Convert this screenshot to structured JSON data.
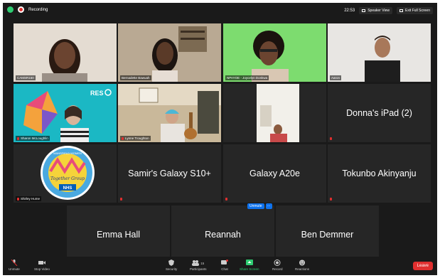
{
  "topbar": {
    "recording_label": "Recording",
    "time": "22:53",
    "speaker_view_label": "Speaker View",
    "exit_fullscreen_label": "Exit Full Screen"
  },
  "participants": [
    {
      "name": "CAMSR160",
      "type": "video",
      "active_speaker": true
    },
    {
      "name": "Bernadette Bawuah",
      "type": "video"
    },
    {
      "name": "NPAYOE - Joycelyn Donkwa",
      "type": "video"
    },
    {
      "name": "Aaron",
      "type": "video"
    },
    {
      "name": "Sharon McLoughlin",
      "type": "video",
      "muted": true
    },
    {
      "name": "Lynne Troughton",
      "type": "video",
      "muted": true
    },
    {
      "name": "",
      "type": "video"
    },
    {
      "name": "Donna's iPad (2)",
      "type": "name-only",
      "muted": true
    },
    {
      "name": "Shirley Hume",
      "type": "logo",
      "muted": true
    },
    {
      "name": "Samir's Galaxy S10+",
      "type": "name-only",
      "muted": true
    },
    {
      "name": "Galaxy A20e",
      "type": "name-only",
      "muted": true
    },
    {
      "name": "Tokunbo Akinyanju",
      "type": "name-only",
      "muted": true
    },
    {
      "name": "Emma Hall",
      "type": "name-only",
      "muted": true
    },
    {
      "name": "Reannah",
      "type": "name-only",
      "muted": true
    },
    {
      "name": "Ben Demmer",
      "type": "name-only"
    }
  ],
  "resolve_logo_text": "RES",
  "group_logo": {
    "top_text": "MANSFIELD WOMEN",
    "script_text": "Together Group",
    "badge": "NHS"
  },
  "hover_controls": {
    "unmute_label": "Unmute",
    "more_label": "···"
  },
  "toolbar": {
    "unmute_label": "Unmute",
    "stop_video_label": "Stop Video",
    "security_label": "Security",
    "participants_label": "Participants",
    "participants_count": "15",
    "chat_label": "Chat",
    "share_screen_label": "Share Screen",
    "record_label": "Record",
    "reactions_label": "Reactions",
    "leave_label": "Leave"
  },
  "colors": {
    "accent_green": "#b9d83b",
    "leave_red": "#e02f2f",
    "share_green": "#2ecc71",
    "unmute_blue": "#0e72ed"
  }
}
